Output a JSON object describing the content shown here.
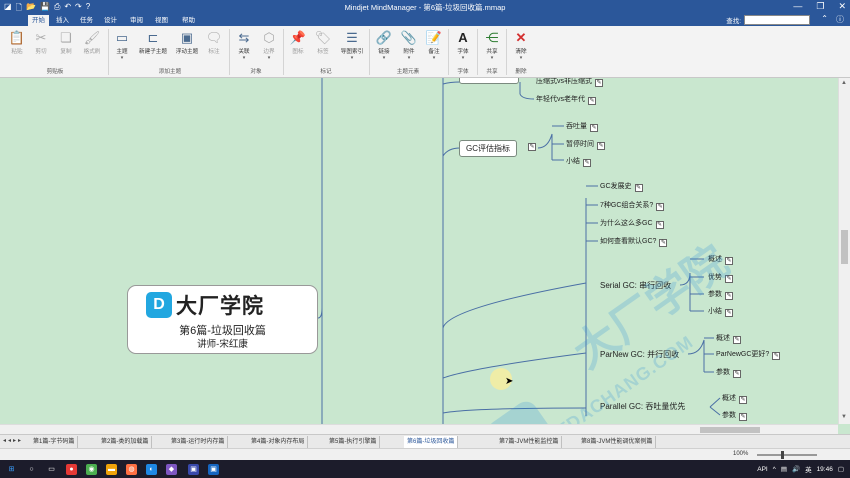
{
  "window": {
    "title": "Mindjet MindManager - 第6篇-垃圾回收篇.mmap",
    "search_label": "查找:",
    "help_icon": "?"
  },
  "menu": {
    "tabs": [
      "开始",
      "插入",
      "任务",
      "设计",
      "审阅",
      "视图",
      "帮助"
    ],
    "active": "开始"
  },
  "ribbon": {
    "buttons": [
      {
        "label": "粘贴",
        "icon": "clipboard-icon",
        "disabled": true
      },
      {
        "label": "剪切",
        "icon": "scissors-icon",
        "disabled": true
      },
      {
        "label": "复制",
        "icon": "copy-icon",
        "disabled": true
      },
      {
        "label": "格式刷",
        "icon": "brush-icon",
        "disabled": true
      },
      {
        "label": "主题",
        "icon": "topic-icon",
        "disabled": false
      },
      {
        "label": "新建子主题",
        "icon": "subtopic-icon",
        "disabled": false
      },
      {
        "label": "浮动主题",
        "icon": "floating-topic-icon",
        "disabled": false
      },
      {
        "label": "标注",
        "icon": "callout-icon",
        "disabled": true
      },
      {
        "label": "关联",
        "icon": "relationship-icon",
        "disabled": false
      },
      {
        "label": "边界",
        "icon": "boundary-icon",
        "disabled": true
      },
      {
        "label": "图标",
        "icon": "pin-icon",
        "disabled": true
      },
      {
        "label": "标签",
        "icon": "tag-icon",
        "disabled": true
      },
      {
        "label": "导图索引",
        "icon": "index-icon",
        "disabled": false
      },
      {
        "label": "链接",
        "icon": "link-icon",
        "disabled": false
      },
      {
        "label": "附件",
        "icon": "attachment-icon",
        "disabled": false
      },
      {
        "label": "备注",
        "icon": "notes-icon",
        "disabled": false
      },
      {
        "label": "字体",
        "icon": "font-icon",
        "disabled": false
      },
      {
        "label": "共享",
        "icon": "share-icon",
        "disabled": false
      },
      {
        "label": "清除",
        "icon": "clear-icon",
        "disabled": false
      }
    ],
    "groups": [
      "剪贴板",
      "添加主题",
      "对象",
      "标记",
      "主题元素",
      "字体",
      "共享",
      "删除"
    ]
  },
  "map": {
    "central": {
      "brand": "大厂学院",
      "title": "第6篇-垃圾回收篇",
      "subtitle": "讲师-宋红康"
    },
    "partial_top": "压缩式vs非压缩式",
    "partial_top2": "年轻代vs老年代",
    "gc_metrics": {
      "label": "GC评估指标",
      "children": [
        "吞吐量",
        "暂停时间",
        "小结"
      ]
    },
    "gc_list": [
      "GC发展史",
      "7种GC组合关系?",
      "为什么这么多GC",
      "如何查看默认GC?"
    ],
    "serial": {
      "label": "Serial GC: 串行回收",
      "children": [
        "概述",
        "优势",
        "参数",
        "小结"
      ]
    },
    "parnew": {
      "label": "ParNew GC: 并行回收",
      "children": [
        "概述",
        "ParNewGC更好?",
        "参数"
      ]
    },
    "parallel": {
      "label": "Parallel GC: 吞吐量优先",
      "children": [
        "概述",
        "参数"
      ]
    },
    "watermark": {
      "cn": "大厂学院",
      "en": "ITDACHANG.COM"
    }
  },
  "sheets": [
    "第1篇-字节码篇",
    "第2篇-类的加载篇",
    "第3篇-运行时内存篇",
    "第4篇-对象内存布局",
    "第5篇-执行引擎篇",
    "第6篇-垃圾回收篇",
    "第7篇-JVM性能监控篇",
    "第8篇-JVM性能调优案例篇"
  ],
  "active_sheet": "第6篇-垃圾回收篇",
  "status": {
    "zoom": "100%"
  },
  "taskbar": {
    "api": "API",
    "ime": "英",
    "time": "19:46"
  }
}
